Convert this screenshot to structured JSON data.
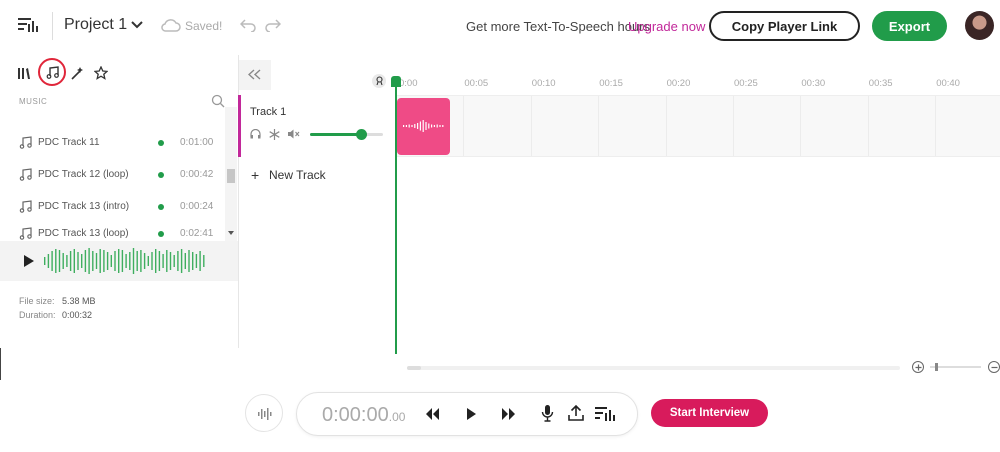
{
  "header": {
    "project_name": "Project 1",
    "save_status": "Saved!",
    "promo_text": "Get more Text-To-Speech hours",
    "upgrade_label": "Upgrade now",
    "copy_link_label": "Copy Player Link",
    "export_label": "Export"
  },
  "sidebar": {
    "tabs": [
      {
        "icon": "library-icon"
      },
      {
        "icon": "music-note-icon",
        "active": true
      },
      {
        "icon": "magic-wand-icon"
      },
      {
        "icon": "star-icon"
      }
    ],
    "section_label": "MUSIC",
    "tracks": [
      {
        "name": "PDC Track 11",
        "duration": "0:01:00"
      },
      {
        "name": "PDC Track 12 (loop)",
        "duration": "0:00:42"
      },
      {
        "name": "PDC Track 13 (intro)",
        "duration": "0:00:24"
      },
      {
        "name": "PDC Track 13 (loop)",
        "duration": "0:02:41"
      }
    ],
    "details": {
      "file_size_label": "File size:",
      "file_size": "5.38 MB",
      "duration_label": "Duration:",
      "duration": "0:00:32"
    }
  },
  "timeline": {
    "ticks": [
      "0:00",
      "00:05",
      "00:10",
      "00:15",
      "00:20",
      "00:25",
      "00:30",
      "00:35",
      "00:40"
    ],
    "track_name": "Track 1",
    "new_track_label": "New Track",
    "volume_level": 0.7
  },
  "transport": {
    "time_main": "0:00:00",
    "time_fraction": ".00",
    "start_interview_label": "Start Interview"
  },
  "colors": {
    "accent_green": "#219c4a",
    "accent_pink": "#d81b5c",
    "clip_pink": "#ef4b86",
    "upgrade_purple": "#c2289a"
  }
}
